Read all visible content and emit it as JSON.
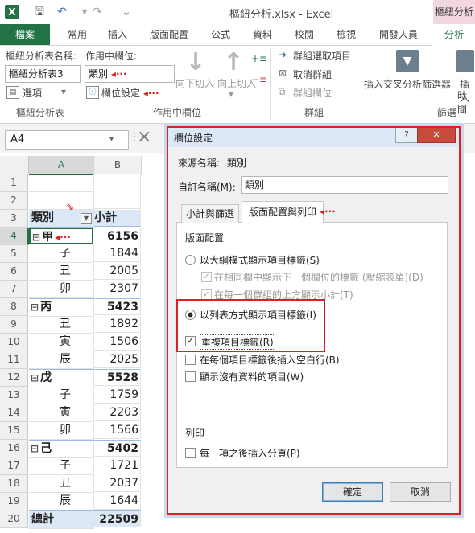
{
  "window": {
    "app_logo": "X",
    "title": "樞紐分析.xlsx - Excel",
    "context_tab_title": "樞紐分析",
    "quick_access": [
      "save-icon",
      "undo-icon",
      "redo-icon",
      "more-icon"
    ]
  },
  "tabs": [
    "檔案",
    "常用",
    "插入",
    "版面配置",
    "公式",
    "資料",
    "校閱",
    "檢視",
    "開發人員",
    "分析"
  ],
  "ribbon": {
    "pivot_name_label": "樞紐分析表名稱:",
    "pivot_name_value": "樞紐分析表3",
    "options_label": "選項",
    "group_pivot": "樞紐分析表",
    "active_field_label": "作用中欄位:",
    "active_field_value": "類別",
    "field_settings_label": "欄位設定",
    "drill_down": "向下切入",
    "drill_up": "向上切入",
    "drill_up_arrow": "▾",
    "group_active_field": "作用中欄位",
    "group_selection": "群組選取項目",
    "ungroup": "取消群組",
    "group_field": "群組欄位",
    "group_group": "群組",
    "insert_slicer": "插入交叉分析篩選器",
    "insert_timeline": "插入",
    "insert_timeline_2": "時間",
    "group_filter": "篩選"
  },
  "formula_bar": {
    "name_box": "A4",
    "cancel_icon": "×"
  },
  "sheet": {
    "columns": [
      "A",
      "B"
    ],
    "rows": [
      {
        "n": "1",
        "a": "",
        "b": ""
      },
      {
        "n": "2",
        "a": "",
        "b": ""
      },
      {
        "n": "3",
        "a": "類別",
        "b": "小計",
        "kind": "header"
      },
      {
        "n": "4",
        "a": "甲",
        "b": "6156",
        "kind": "group"
      },
      {
        "n": "5",
        "a": "子",
        "b": "1844",
        "kind": "item"
      },
      {
        "n": "6",
        "a": "丑",
        "b": "2005",
        "kind": "item"
      },
      {
        "n": "7",
        "a": "卯",
        "b": "2307",
        "kind": "item"
      },
      {
        "n": "8",
        "a": "丙",
        "b": "5423",
        "kind": "group"
      },
      {
        "n": "9",
        "a": "丑",
        "b": "1892",
        "kind": "item"
      },
      {
        "n": "10",
        "a": "寅",
        "b": "1506",
        "kind": "item"
      },
      {
        "n": "11",
        "a": "辰",
        "b": "2025",
        "kind": "item"
      },
      {
        "n": "12",
        "a": "戊",
        "b": "5528",
        "kind": "group"
      },
      {
        "n": "13",
        "a": "子",
        "b": "1759",
        "kind": "item"
      },
      {
        "n": "14",
        "a": "寅",
        "b": "2203",
        "kind": "item"
      },
      {
        "n": "15",
        "a": "卯",
        "b": "1566",
        "kind": "item"
      },
      {
        "n": "16",
        "a": "己",
        "b": "5402",
        "kind": "group"
      },
      {
        "n": "17",
        "a": "子",
        "b": "1721",
        "kind": "item"
      },
      {
        "n": "18",
        "a": "丑",
        "b": "2037",
        "kind": "item"
      },
      {
        "n": "19",
        "a": "辰",
        "b": "1644",
        "kind": "item"
      },
      {
        "n": "20",
        "a": "總計",
        "b": "22509",
        "kind": "total"
      }
    ],
    "collapse_glyph": "⊟"
  },
  "dialog": {
    "title": "欄位設定",
    "help": "?",
    "close": "✕",
    "source_name_label": "來源名稱:",
    "source_name_value": "類別",
    "custom_name_label": "自訂名稱(M):",
    "custom_name_value": "類別",
    "tab_subtotals": "小計與篩選",
    "tab_layout": "版面配置與列印",
    "section_layout": "版面配置",
    "opt_outline": "以大綱模式顯示項目標籤(S)",
    "opt_outline_sub1": "在相同欄中顯示下一個欄位的標籤 (壓縮表單)(D)",
    "opt_outline_sub2": "在每一個群組的上方顯示小計(T)",
    "opt_tabular": "以列表方式顯示項目標籤(I)",
    "opt_repeat": "重複項目標籤(R)",
    "opt_blank_line": "在每個項目標籤後插入空白行(B)",
    "opt_show_no_data": "顯示沒有資料的項目(W)",
    "section_print": "列印",
    "opt_page_break": "每一項之後插入分頁(P)",
    "checkmark": "✓",
    "ok": "確定",
    "cancel": "取消"
  },
  "annotation_arrow": "◂···"
}
